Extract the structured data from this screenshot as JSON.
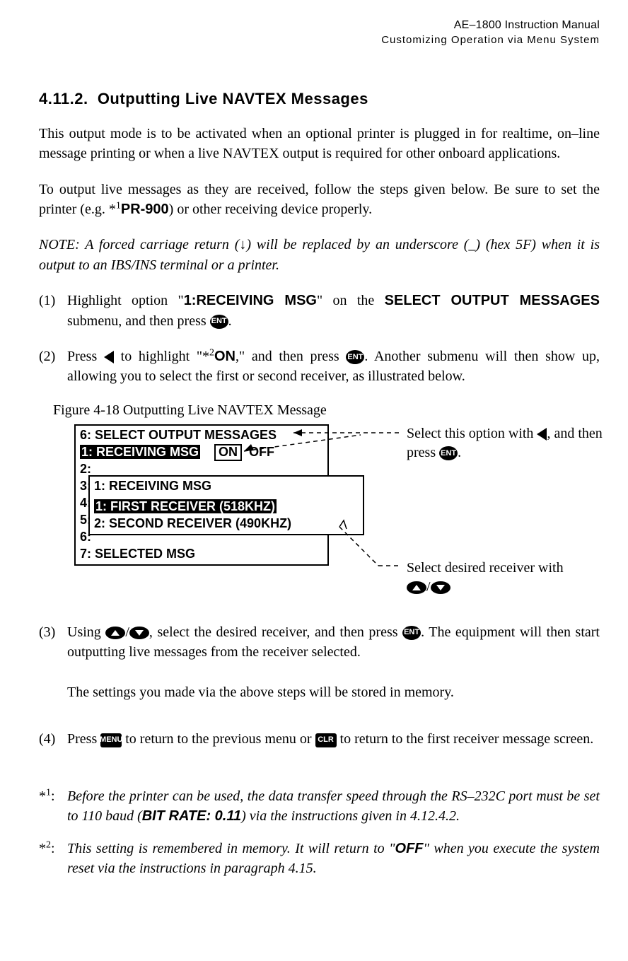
{
  "header": {
    "line1": "AE–1800 Instruction Manual",
    "line2": "Customizing Operation via Menu System"
  },
  "section": {
    "number": "4.11.2.",
    "title": "Outputting Live NAVTEX Messages"
  },
  "para1": "This output mode is to be activated when an optional printer is plugged in for realtime, on–line message printing or when a live NAVTEX output is required for other onboard applications.",
  "para2_a": "To output live messages as they are received, follow the steps given below. Be sure to set the printer (e.g. ",
  "para2_ref": "*1",
  "para2_bold": "PR-900",
  "para2_b": ") or other receiving device properly.",
  "note": "NOTE: A forced carriage return (↓) will be replaced by an underscore (_) (hex 5F) when it is output to an IBS/INS terminal or a printer.",
  "steps": {
    "s1": {
      "num": "(1)",
      "a": "Highlight option \"",
      "opt": "1:RECEIVING MSG",
      "b": "\" on the ",
      "menu": "SELECT OUTPUT MESSAGES",
      "c": " submenu, and then press ",
      "d": "."
    },
    "s2": {
      "num": "(2)",
      "a": "Press ",
      "b": " to highlight \"",
      "ref": "*2",
      "on": "ON",
      "c": ",\" and then press ",
      "d": ".  Another submenu will then show up, allowing you to select the first or second receiver, as illustrated below."
    },
    "s3": {
      "num": "(3)",
      "a": "Using ",
      "b": ", select the desired receiver, and then press ",
      "c": ". The equipment will then start outputting live messages from the receiver selected.",
      "d": "The settings you made via the above steps will be stored in memory."
    },
    "s4": {
      "num": "(4)",
      "a": "Press ",
      "b": " to return to the previous menu or ",
      "c": " to return to the first receiver message screen."
    }
  },
  "figure": {
    "caption": "Figure 4-18    Outputting Live NAVTEX Message",
    "main": {
      "title": "6: SELECT OUTPUT MESSAGES",
      "row1_label": "1: RECEIVING MSG",
      "row1_on": "ON",
      "row1_off": "OFF",
      "rows": [
        "2:",
        "3:",
        "4:",
        "5:",
        "6:"
      ],
      "row7": "7: SELECTED MSG"
    },
    "sub": {
      "title": " 1: RECEIVING MSG",
      "opt1": "1: FIRST RECEIVER (518KHZ) ",
      "opt2": "2: SECOND RECEIVER (490KHZ)"
    },
    "annot_top_a": "Select this option with ",
    "annot_top_b": ", and then press ",
    "annot_top_c": ".",
    "annot_bot": "Select desired receiver with",
    "slash": "/"
  },
  "footnotes": {
    "f1": {
      "lbl": "*1:",
      "a": "Before the printer can be used, the data transfer speed through the RS–232C port must be set to 110 baud (",
      "bold": "BIT RATE: 0.11",
      "b": ") via the instructions given in 4.12.4.2."
    },
    "f2": {
      "lbl": "*2:",
      "a": "This setting is remembered in memory. It will return to \"",
      "bold": "OFF",
      "b": "\" when you execute the system reset via the instructions in paragraph 4.15."
    }
  },
  "keys": {
    "ent": "ENT",
    "menu": "MENU",
    "clr": "CLR"
  }
}
